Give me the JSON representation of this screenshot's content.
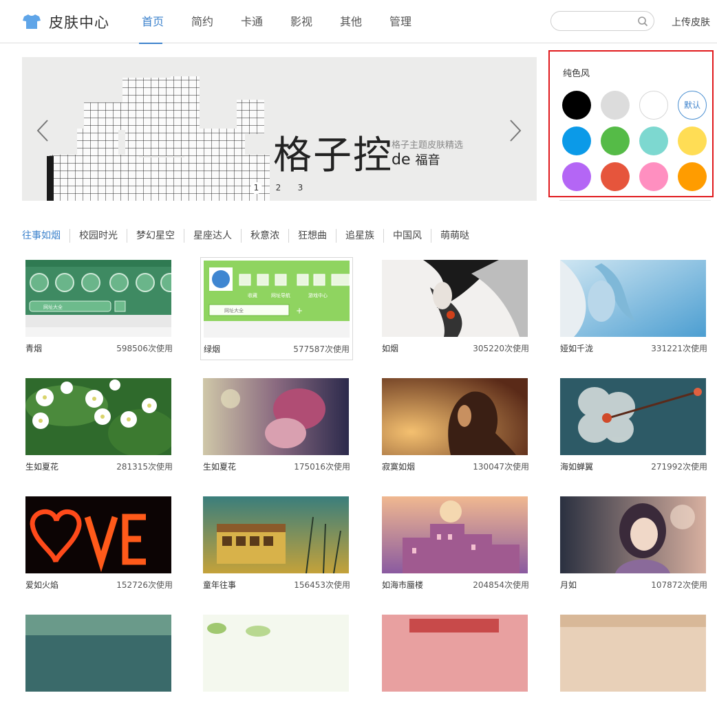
{
  "header": {
    "title": "皮肤中心",
    "nav": [
      "首页",
      "简约",
      "卡通",
      "影视",
      "其他",
      "管理"
    ],
    "search_placeholder": "",
    "upload_label": "上传皮肤"
  },
  "banner": {
    "title": "格子控",
    "subtitle": "格子主题皮肤精选",
    "de": "de",
    "tagline": "福音",
    "dots": [
      "1",
      "2",
      "3"
    ]
  },
  "color_panel": {
    "title": "纯色风",
    "default_label": "默认",
    "colors": [
      "#000000",
      "#dcdcdc",
      "#ffffff",
      "default",
      "#0b9ae8",
      "#55bb47",
      "#7dd8d0",
      "#ffdd55",
      "#b466f5",
      "#e6553c",
      "#ff8fc0",
      "#ff9c00"
    ]
  },
  "categories": [
    "往事如烟",
    "校园时光",
    "梦幻星空",
    "星座达人",
    "秋意浓",
    "狂想曲",
    "追星族",
    "中国风",
    "萌萌哒"
  ],
  "skins": [
    {
      "name": "青烟",
      "uses": "598506次使用"
    },
    {
      "name": "绿烟",
      "uses": "577587次使用"
    },
    {
      "name": "如烟",
      "uses": "305220次使用"
    },
    {
      "name": "娅如千泷",
      "uses": "331221次使用"
    },
    {
      "name": "生如夏花",
      "uses": "281315次使用"
    },
    {
      "name": "生如夏花",
      "uses": "175016次使用"
    },
    {
      "name": "寂寞如烟",
      "uses": "130047次使用"
    },
    {
      "name": "海如蝉翼",
      "uses": "271992次使用"
    },
    {
      "name": "爱如火焰",
      "uses": "152726次使用"
    },
    {
      "name": "童年往事",
      "uses": "156453次使用"
    },
    {
      "name": "如海市蜃楼",
      "uses": "204854次使用"
    },
    {
      "name": "月如",
      "uses": "107872次使用"
    }
  ],
  "thumb_labels": {
    "green_tab": "网址大全",
    "nav1": "收藏",
    "nav2": "网址导航",
    "nav3": "游戏中心"
  }
}
